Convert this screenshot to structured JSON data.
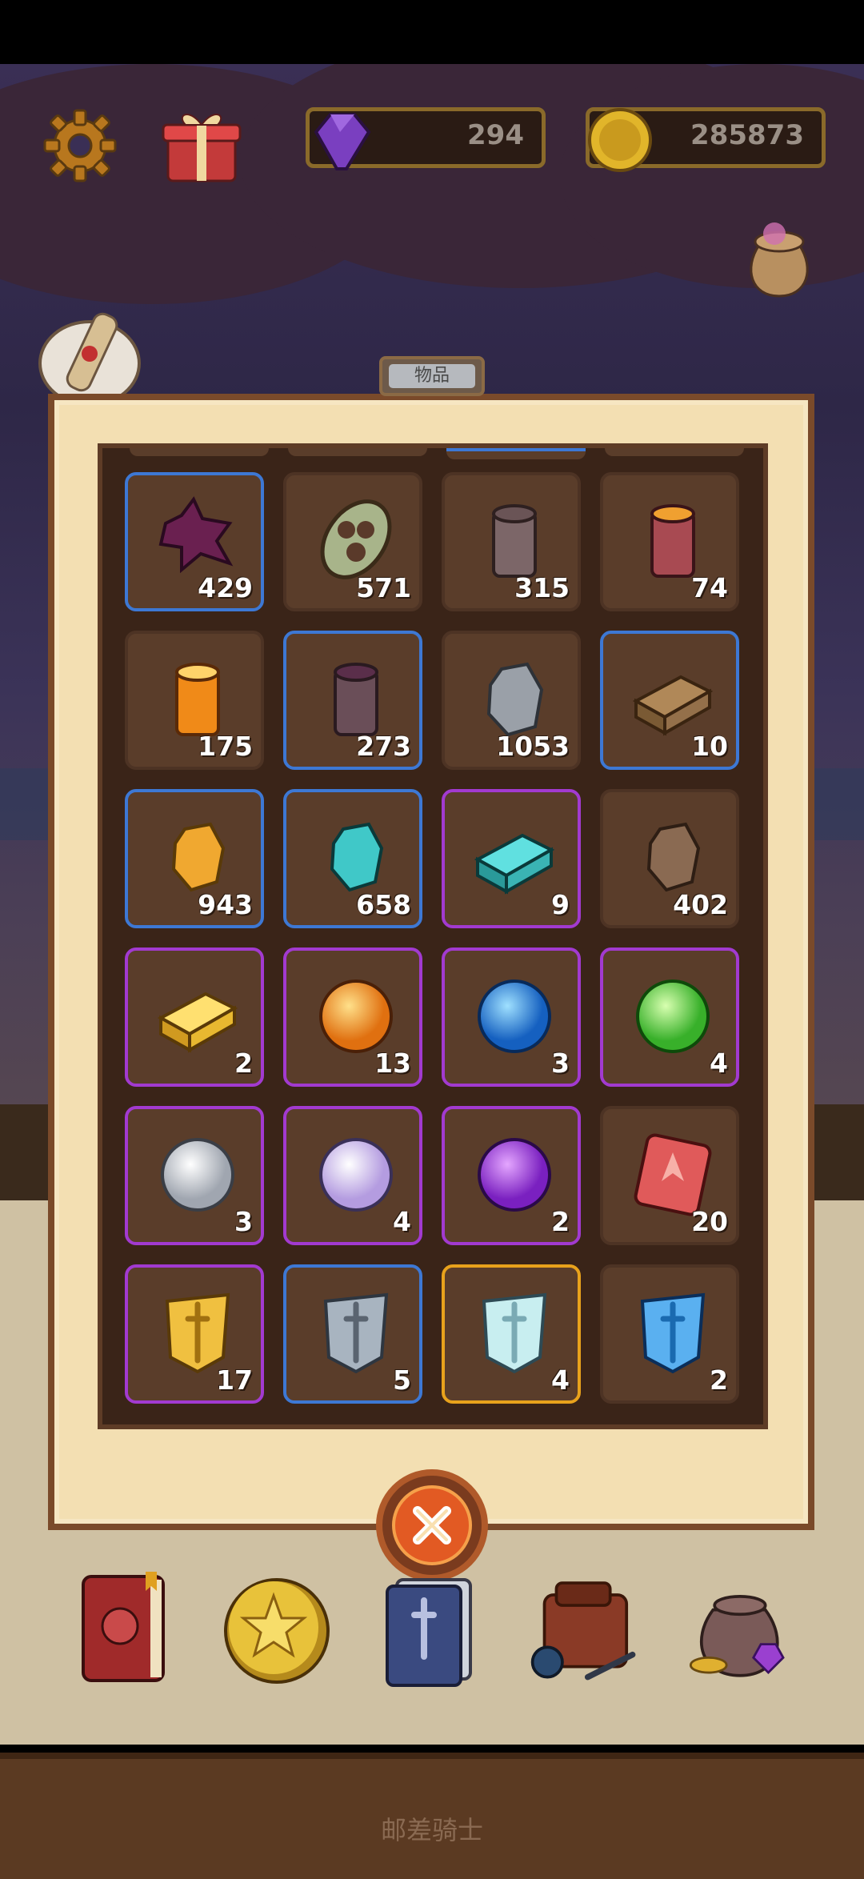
{
  "header": {
    "gems": "294",
    "coins": "285873"
  },
  "panel": {
    "tab_label": "物品"
  },
  "items": [
    {
      "icon": "purple-hide-icon",
      "count": "429",
      "rarity": "blue"
    },
    {
      "icon": "tribal-mask-icon",
      "count": "571",
      "rarity": "none"
    },
    {
      "icon": "gray-wood-log-icon",
      "count": "315",
      "rarity": "none"
    },
    {
      "icon": "red-wood-log-icon",
      "count": "74",
      "rarity": "none"
    },
    {
      "icon": "orange-wood-log-icon",
      "count": "175",
      "rarity": "none"
    },
    {
      "icon": "dark-wood-log-icon",
      "count": "273",
      "rarity": "blue"
    },
    {
      "icon": "gray-stone-icon",
      "count": "1053",
      "rarity": "none"
    },
    {
      "icon": "bronze-ingot-icon",
      "count": "10",
      "rarity": "blue"
    },
    {
      "icon": "gold-ore-icon",
      "count": "943",
      "rarity": "blue"
    },
    {
      "icon": "cyan-ore-icon",
      "count": "658",
      "rarity": "blue"
    },
    {
      "icon": "cyan-ingot-icon",
      "count": "9",
      "rarity": "purple"
    },
    {
      "icon": "brown-ore-icon",
      "count": "402",
      "rarity": "none"
    },
    {
      "icon": "gold-ingot-icon",
      "count": "2",
      "rarity": "purple"
    },
    {
      "icon": "orange-orb-icon",
      "count": "13",
      "rarity": "purple"
    },
    {
      "icon": "blue-orb-icon",
      "count": "3",
      "rarity": "purple"
    },
    {
      "icon": "green-orb-icon",
      "count": "4",
      "rarity": "purple"
    },
    {
      "icon": "white-orb-icon",
      "count": "3",
      "rarity": "purple"
    },
    {
      "icon": "lavender-orb-icon",
      "count": "4",
      "rarity": "purple"
    },
    {
      "icon": "purple-orb-icon",
      "count": "2",
      "rarity": "purple"
    },
    {
      "icon": "red-rune-tablet-icon",
      "count": "20",
      "rarity": "none"
    },
    {
      "icon": "gold-sword-crest-icon",
      "count": "17",
      "rarity": "purple"
    },
    {
      "icon": "silver-sword-crest-icon",
      "count": "5",
      "rarity": "blue"
    },
    {
      "icon": "ice-sword-crest-icon",
      "count": "4",
      "rarity": "gold"
    },
    {
      "icon": "blue-sword-crest-icon",
      "count": "2",
      "rarity": "none"
    }
  ],
  "nav": [
    "spellbook-icon",
    "star-coin-icon",
    "card-deck-icon",
    "backpack-icon",
    "treasure-bag-icon"
  ],
  "footer": {
    "title": "邮差骑士"
  },
  "colors": {
    "rarity_blue": "#3d78d4",
    "rarity_purple": "#a23ad0",
    "rarity_gold": "#e8a21c",
    "panel_bg": "#f3dfb2",
    "close_button": "#e25a23"
  }
}
